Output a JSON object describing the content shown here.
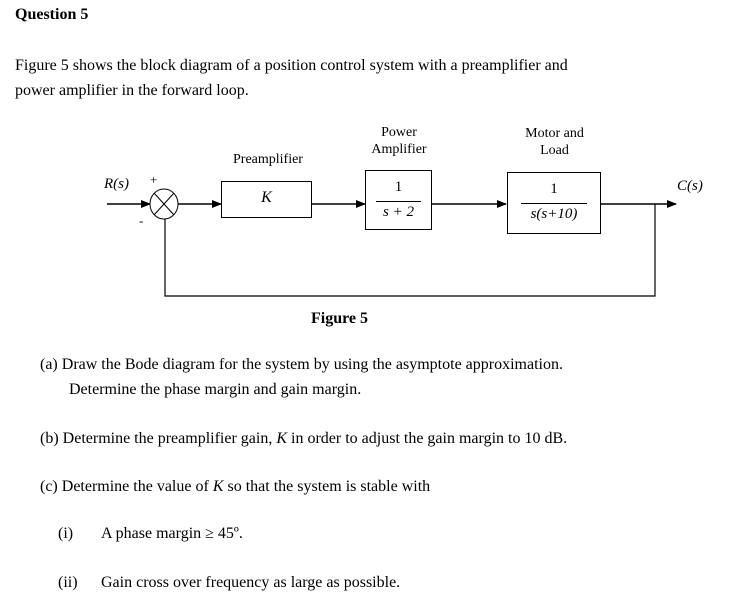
{
  "question": {
    "title": "Question 5",
    "intro_line1": "Figure 5 shows the block diagram of a position control system with a preamplifier and",
    "intro_line2": "power amplifier in the forward loop."
  },
  "diagram": {
    "input_label": "R(s)",
    "output_label": "C(s)",
    "sum_plus": "+",
    "sum_minus": "-",
    "blocks": [
      {
        "title_line1": "Preamplifier",
        "title_line2": "",
        "tf": "K"
      },
      {
        "title_line1": "Power",
        "title_line2": "Amplifier",
        "numerator": "1",
        "denominator": "s + 2"
      },
      {
        "title_line1": "Motor and",
        "title_line2": "Load",
        "numerator": "1",
        "denominator": "s(s+10)"
      }
    ],
    "caption": "Figure 5"
  },
  "parts": {
    "a_line1": "(a) Draw the Bode diagram for the system by using the asymptote approximation.",
    "a_line2": "Determine the phase margin and gain margin.",
    "b_prefix": "(b) Determine the preamplifier gain, ",
    "b_var": "K",
    "b_suffix": " in order to adjust the gain margin to 10 dB.",
    "c_prefix": "(c) Determine the value of ",
    "c_var": "K",
    "c_suffix": " so that the system is stable with",
    "c_i_num": "(i)",
    "c_i_text": "A phase margin ≥ 45º.",
    "c_ii_num": "(ii)",
    "c_ii_text": "Gain cross over frequency as large as possible."
  }
}
